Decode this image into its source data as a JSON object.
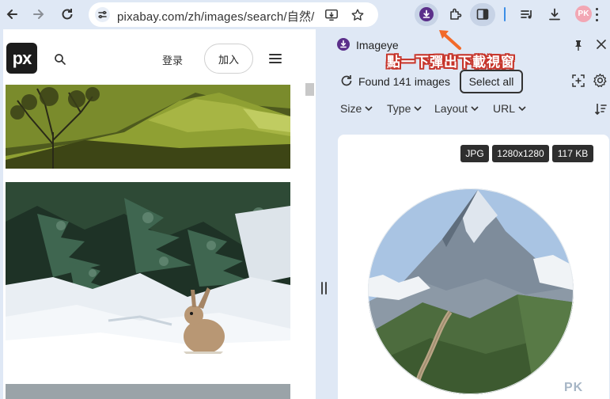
{
  "browser": {
    "url": "pixabay.com/zh/images/search/自然/",
    "profile_initials": "PK",
    "accent_color": "#3b8ee6"
  },
  "page": {
    "logo_text": "px",
    "login_label": "登录",
    "join_label": "加入"
  },
  "panel": {
    "title": "Imageye",
    "annotation": "點一下彈出下載視窗",
    "found_text": "Found 141 images",
    "select_all_label": "Select all",
    "filters": [
      {
        "label": "Size"
      },
      {
        "label": "Type"
      },
      {
        "label": "Layout"
      },
      {
        "label": "URL"
      }
    ],
    "card": {
      "format": "JPG",
      "dimensions": "1280x1280",
      "size": "117 KB"
    }
  },
  "watermark": "PK"
}
